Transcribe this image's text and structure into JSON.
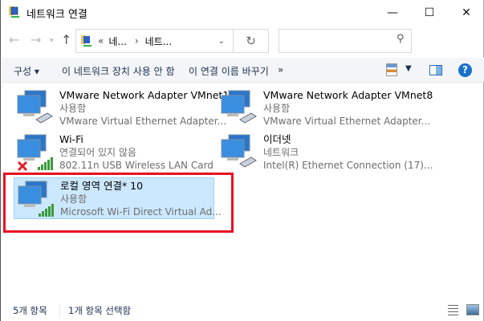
{
  "window": {
    "title": "네트워크 연결"
  },
  "address": {
    "crumbs": [
      "«",
      "네...",
      "›",
      "네트..."
    ],
    "search_placeholder": ""
  },
  "toolbar": {
    "organize": "구성 ▾",
    "disable": "이 네트워크 장치 사용 안 함",
    "rename": "이 연결 이름 바꾸기",
    "more": "»"
  },
  "items": [
    {
      "name": "VMware Network Adapter VMnet1",
      "status": "사용함",
      "device": "VMware Virtual Ethernet Adapter...",
      "type": "ethernet",
      "selected": false
    },
    {
      "name": "VMware Network Adapter VMnet8",
      "status": "사용함",
      "device": "VMware Virtual Ethernet Adapter...",
      "type": "ethernet",
      "selected": false
    },
    {
      "name": "Wi-Fi",
      "status": "연결되어 있지 않음",
      "device": "802.11n USB Wireless LAN Card",
      "type": "wifi-disconnected",
      "selected": false
    },
    {
      "name": "이더넷",
      "status": "네트워크",
      "device": "Intel(R) Ethernet Connection (17)...",
      "type": "ethernet",
      "selected": false
    },
    {
      "name": "로컬 영역 연결* 10",
      "status": "사용함",
      "device": "Microsoft Wi-Fi Direct Virtual Ad...",
      "type": "wifi",
      "selected": true
    }
  ],
  "statusbar": {
    "count": "5개 항목",
    "selected": "1개 항목 선택함"
  },
  "colors": {
    "selection": "#cce8ff",
    "highlight": "#e81123",
    "help": "#1a6fc9"
  }
}
